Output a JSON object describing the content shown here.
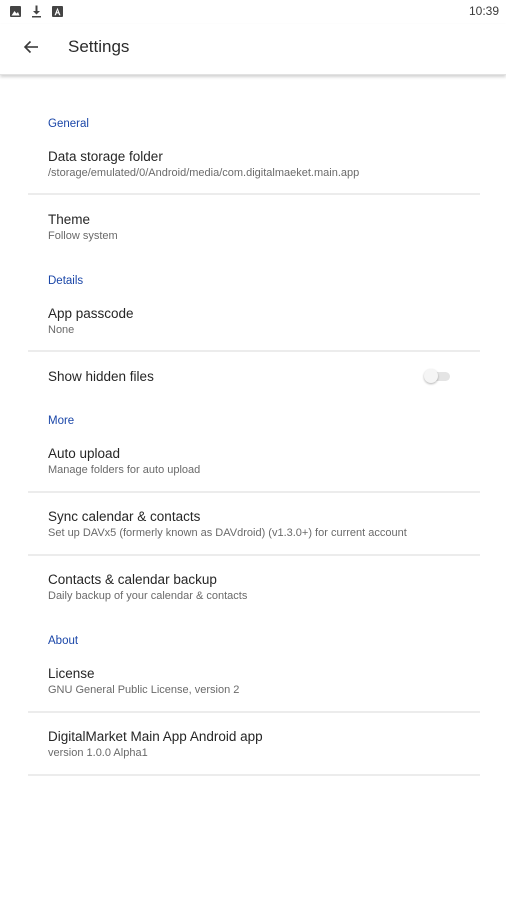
{
  "status_bar": {
    "time": "10:39",
    "icons": [
      "image-icon",
      "download-icon",
      "a-letter-icon"
    ]
  },
  "app_bar": {
    "back_icon": "arrow-back-icon",
    "title": "Settings"
  },
  "sections": {
    "general": {
      "header": "General",
      "data_storage": {
        "title": "Data storage folder",
        "summary": "/storage/emulated/0/Android/media/com.digitalmaeket.main.app"
      },
      "theme": {
        "title": "Theme",
        "summary": "Follow system"
      }
    },
    "details": {
      "header": "Details",
      "passcode": {
        "title": "App passcode",
        "summary": "None"
      },
      "hidden_files": {
        "title": "Show hidden files",
        "enabled": false
      }
    },
    "more": {
      "header": "More",
      "auto_upload": {
        "title": "Auto upload",
        "summary": "Manage folders for auto upload"
      },
      "sync": {
        "title": "Sync calendar & contacts",
        "summary": "Set up DAVx5 (formerly known as DAVdroid) (v1.3.0+) for current account"
      },
      "backup": {
        "title": "Contacts & calendar backup",
        "summary": "Daily backup of your calendar & contacts"
      }
    },
    "about": {
      "header": "About",
      "license": {
        "title": "License",
        "summary": "GNU General Public License, version 2"
      },
      "app": {
        "title": "DigitalMarket Main App Android app",
        "summary": "version 1.0.0 Alpha1"
      }
    }
  },
  "colors": {
    "accent": "#1a46a8",
    "divider": "#ececec"
  }
}
